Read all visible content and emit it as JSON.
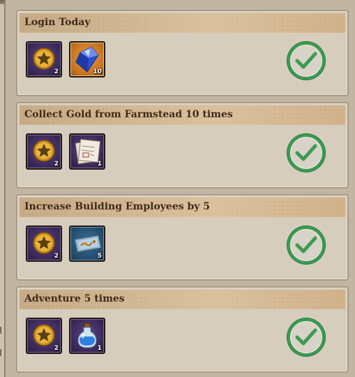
{
  "tasks": [
    {
      "title": "Login Today",
      "rewards": [
        {
          "icon": "gold-star-coin-icon",
          "count": "2",
          "rarity": "purple"
        },
        {
          "icon": "blue-crystal-icon",
          "count": "10",
          "rarity": "orange"
        }
      ],
      "status": "completed"
    },
    {
      "title": "Collect Gold from Farmstead 10 times",
      "rewards": [
        {
          "icon": "gold-star-coin-icon",
          "count": "2",
          "rarity": "purple"
        },
        {
          "icon": "blueprint-scroll-icon",
          "count": "1",
          "rarity": "purple"
        }
      ],
      "status": "completed"
    },
    {
      "title": "Increase Building Employees by 5",
      "rewards": [
        {
          "icon": "gold-star-coin-icon",
          "count": "2",
          "rarity": "purple"
        },
        {
          "icon": "treasure-map-icon",
          "count": "5",
          "rarity": "blue"
        }
      ],
      "status": "completed"
    },
    {
      "title": "Adventure 5 times",
      "rewards": [
        {
          "icon": "gold-star-coin-icon",
          "count": "2",
          "rarity": "purple"
        },
        {
          "icon": "blue-potion-icon",
          "count": "1",
          "rarity": "purple"
        }
      ],
      "status": "completed"
    }
  ],
  "colors": {
    "card_background": "#d6cdbd",
    "header_tan": "#d2b48c",
    "title_text": "#3e2a18",
    "check_green": "#3b9a52"
  }
}
